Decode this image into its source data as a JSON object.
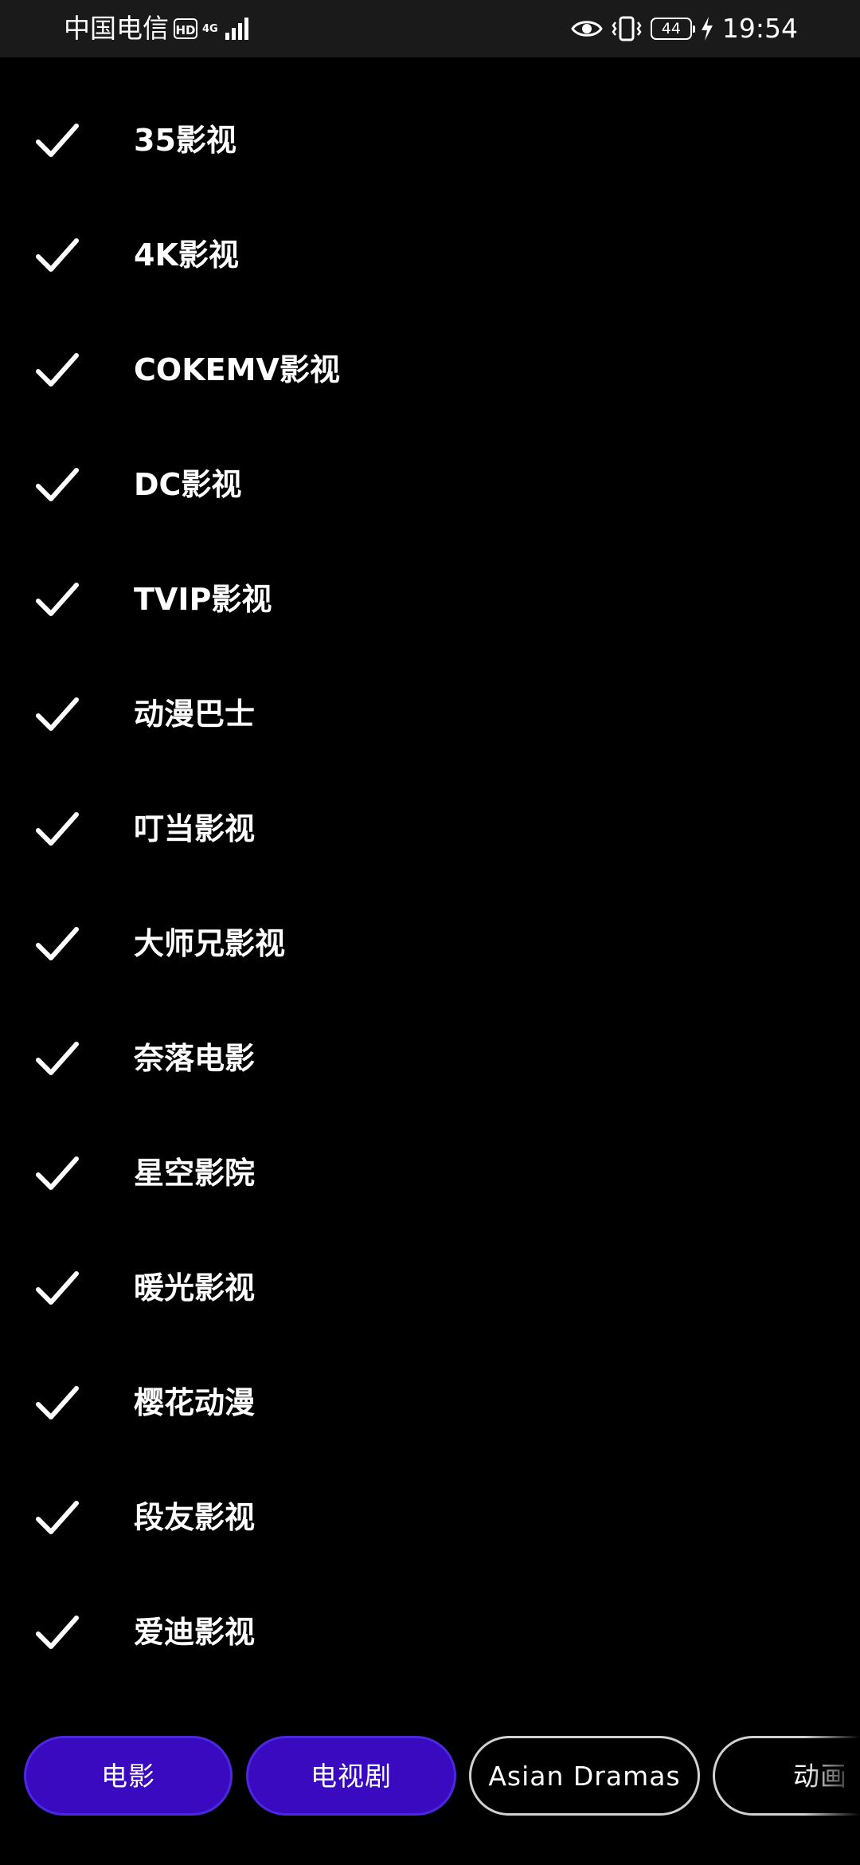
{
  "status_bar": {
    "carrier": "中国电信",
    "hd_badge": "HD",
    "network_type": "4G",
    "battery_level": "44",
    "time": "19:54"
  },
  "sources": {
    "items": [
      {
        "label": "35影视",
        "checked": true
      },
      {
        "label": "4K影视",
        "checked": true
      },
      {
        "label": "COKEMV影视",
        "checked": true
      },
      {
        "label": "DC影视",
        "checked": true
      },
      {
        "label": "TVIP影视",
        "checked": true
      },
      {
        "label": "动漫巴士",
        "checked": true
      },
      {
        "label": "叮当影视",
        "checked": true
      },
      {
        "label": "大师兄影视",
        "checked": true
      },
      {
        "label": "奈落电影",
        "checked": true
      },
      {
        "label": "星空影院",
        "checked": true
      },
      {
        "label": "暖光影视",
        "checked": true
      },
      {
        "label": "樱花动漫",
        "checked": true
      },
      {
        "label": "段友影视",
        "checked": true
      },
      {
        "label": "爱迪影视",
        "checked": true
      }
    ]
  },
  "tabs": [
    {
      "label": "电影",
      "selected": true
    },
    {
      "label": "电视剧",
      "selected": true
    },
    {
      "label": "Asian Dramas",
      "selected": false
    },
    {
      "label": "动画",
      "selected": false
    }
  ],
  "colors": {
    "background": "#000000",
    "selected_tab": "#3a0ac0",
    "unselected_border": "#d0d0d0",
    "text": "#ffffff"
  },
  "icons": {
    "check": "check-icon",
    "eye": "eye-icon",
    "vibrate": "vibrate-icon",
    "charging": "charging-icon",
    "signal": "signal-icon"
  }
}
